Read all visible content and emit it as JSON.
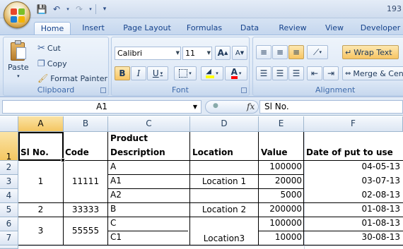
{
  "title": "193",
  "tabs": [
    "Home",
    "Insert",
    "Page Layout",
    "Formulas",
    "Data",
    "Review",
    "View",
    "Developer"
  ],
  "clipboard": {
    "paste_label": "Paste",
    "cut_label": "Cut",
    "copy_label": "Copy",
    "painter_label": "Format Painter",
    "group_label": "Clipboard"
  },
  "font": {
    "family": "Calibri",
    "size": "11",
    "group_label": "Font",
    "bold": "B",
    "italic": "I",
    "underline": "U",
    "grow": "A",
    "shrink": "A"
  },
  "alignment": {
    "wrap_label": "Wrap Text",
    "merge_label": "Merge & Cen",
    "group_label": "Alignment"
  },
  "formula_bar": {
    "name_box": "A1",
    "fx": "fx",
    "content": "Sl No."
  },
  "columns": [
    "A",
    "B",
    "C",
    "D",
    "E",
    "F"
  ],
  "rows": [
    "1",
    "2",
    "3",
    "4",
    "5",
    "6",
    "7"
  ],
  "headers": {
    "sl": "Sl No.",
    "code": "Code",
    "desc_line1": "Product",
    "desc_line2": "Description",
    "location": "Location",
    "value": "Value",
    "date": "Date of put to use"
  },
  "groups": [
    {
      "sl": "1",
      "code": "11111",
      "location": "Location 1"
    },
    {
      "sl": "2",
      "code": "33333",
      "location": "Location 2"
    },
    {
      "sl": "3",
      "code": "55555",
      "location": "Location3"
    }
  ],
  "items": [
    {
      "desc": "A",
      "value": "100000",
      "date": "04-05-13"
    },
    {
      "desc": "A1",
      "value": "20000",
      "date": "03-07-13"
    },
    {
      "desc": "A2",
      "value": "5000",
      "date": "02-08-13"
    },
    {
      "desc": "B",
      "value": "200000",
      "date": "01-08-13"
    },
    {
      "desc": "C",
      "value": "100000",
      "date": "01-08-13"
    },
    {
      "desc": "C1",
      "value": "10000",
      "date": "30-08-13"
    }
  ],
  "colors": {
    "office_logo": [
      "#e8462a",
      "#7bbf2a",
      "#1c7fd6",
      "#f4b400"
    ],
    "fill_yellow": "#ffff00",
    "font_red": "#ff0000"
  }
}
